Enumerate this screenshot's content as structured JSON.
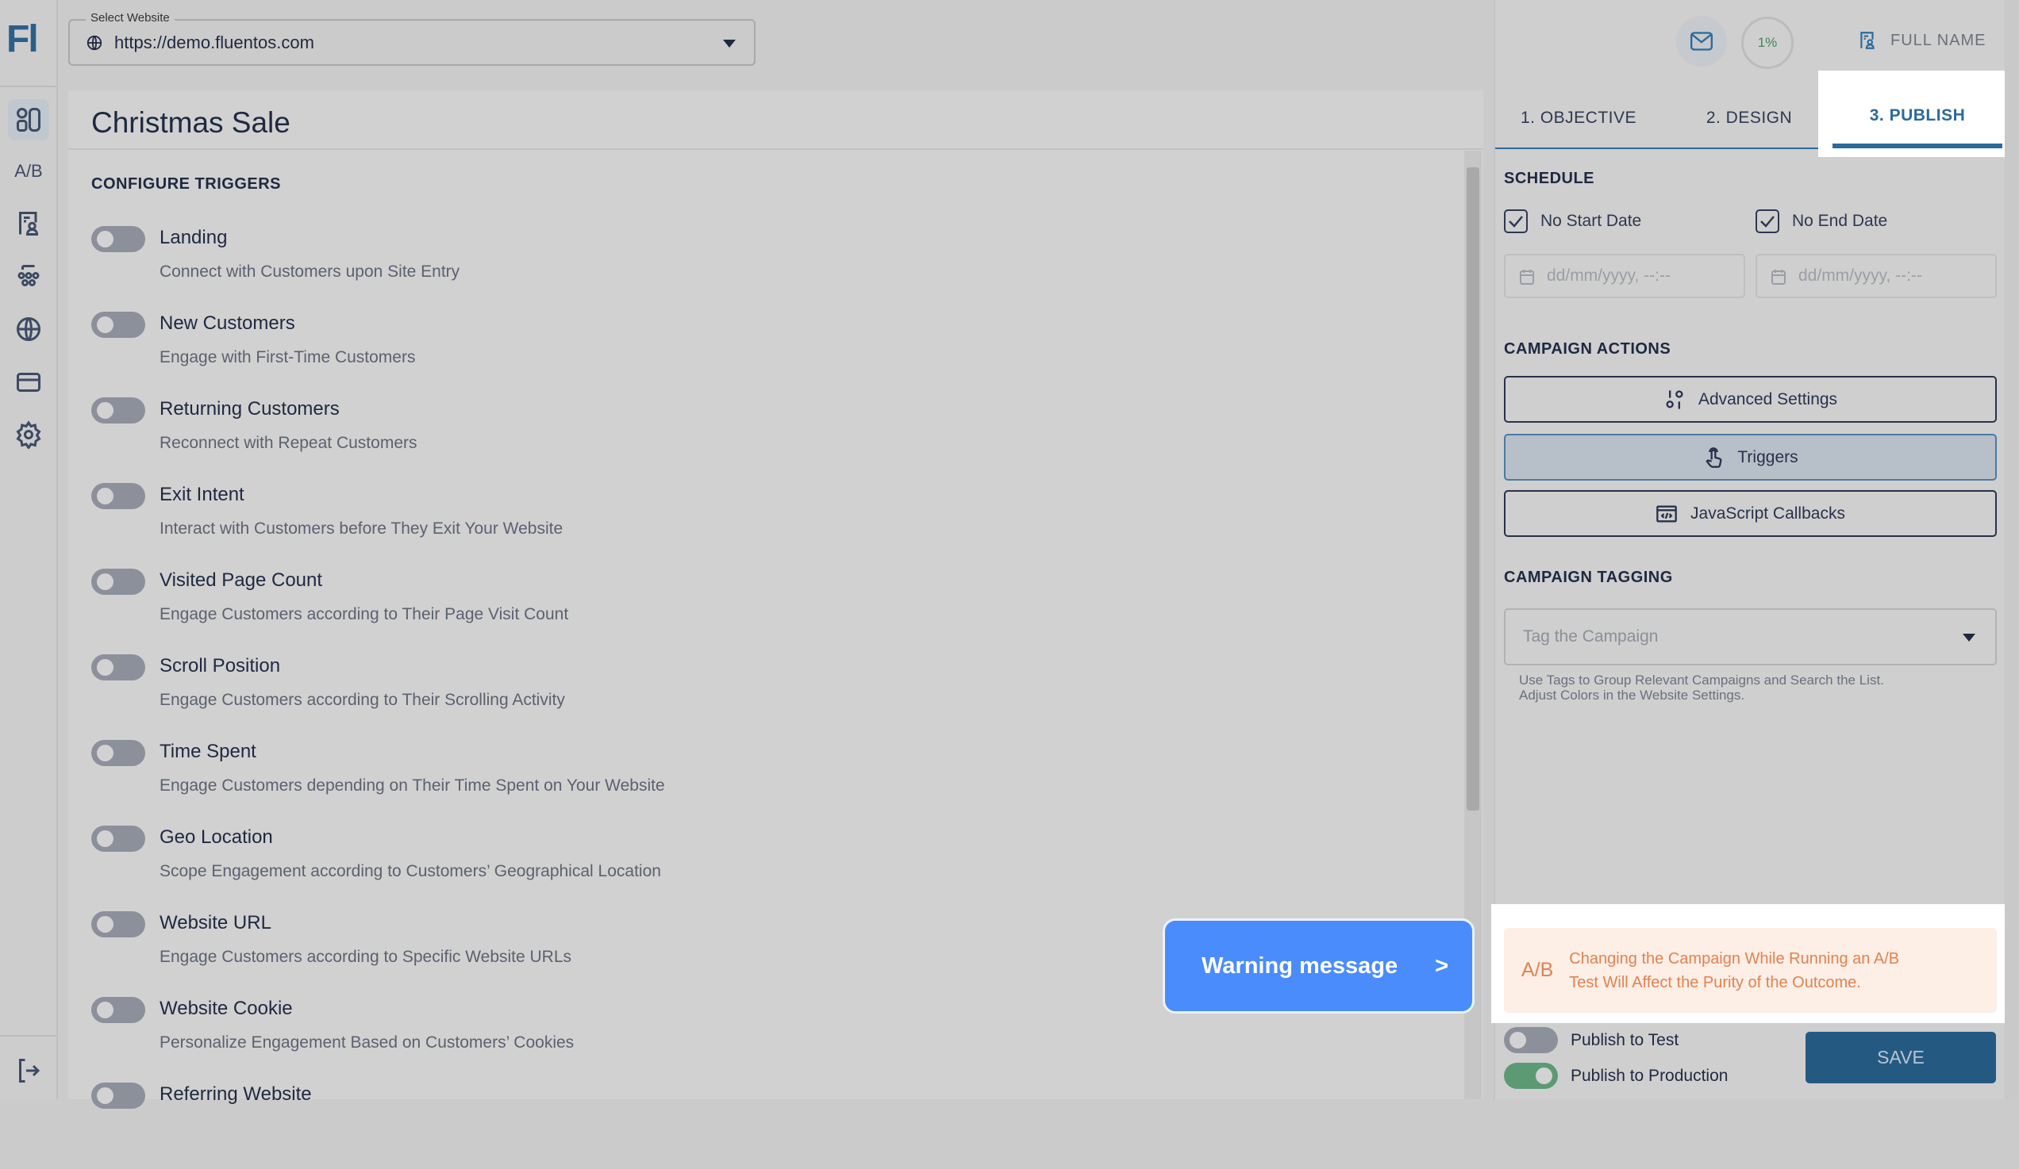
{
  "app": {
    "logo": "Fl"
  },
  "sidebar": {
    "items": [
      {
        "name": "dashboard",
        "icon": "dashboard-icon"
      },
      {
        "name": "ab-test",
        "label": "A/B"
      },
      {
        "name": "contacts",
        "icon": "contact-card-icon"
      },
      {
        "name": "audience",
        "icon": "users-group-icon"
      },
      {
        "name": "websites",
        "icon": "globe-icon"
      },
      {
        "name": "billing",
        "icon": "credit-card-icon"
      },
      {
        "name": "settings",
        "icon": "gear-icon"
      }
    ],
    "logout_icon": "logout-icon"
  },
  "site_select": {
    "label": "Select Website",
    "value": "https://demo.fluentos.com"
  },
  "main": {
    "title": "Christmas Sale",
    "section": "CONFIGURE TRIGGERS",
    "triggers": [
      {
        "title": "Landing",
        "desc": "Connect with Customers upon Site Entry",
        "on": false
      },
      {
        "title": "New Customers",
        "desc": "Engage with First-Time Customers",
        "on": false
      },
      {
        "title": "Returning Customers",
        "desc": "Reconnect with Repeat Customers",
        "on": false
      },
      {
        "title": "Exit Intent",
        "desc": "Interact with Customers before They Exit Your Website",
        "on": false
      },
      {
        "title": "Visited Page Count",
        "desc": "Engage Customers according to Their Page Visit Count",
        "on": false
      },
      {
        "title": "Scroll Position",
        "desc": "Engage Customers according to Their Scrolling Activity",
        "on": false
      },
      {
        "title": "Time Spent",
        "desc": "Engage Customers depending on Their Time Spent on Your Website",
        "on": false
      },
      {
        "title": "Geo Location",
        "desc": "Scope Engagement according to Customers’ Geographical Location",
        "on": false
      },
      {
        "title": "Website URL",
        "desc": "Engage Customers according to Specific Website URLs",
        "on": false
      },
      {
        "title": "Website Cookie",
        "desc": "Personalize Engagement Based on Customers’ Cookies",
        "on": false
      },
      {
        "title": "Referring Website",
        "desc": "",
        "on": false
      }
    ]
  },
  "header": {
    "progress": "1%",
    "progress_value": 1,
    "user": "FULL NAME"
  },
  "tabs": [
    {
      "label": "1. OBJECTIVE"
    },
    {
      "label": "2. DESIGN"
    },
    {
      "label": "3. PUBLISH",
      "active": true
    }
  ],
  "schedule": {
    "heading": "SCHEDULE",
    "no_start": "No Start Date",
    "no_end": "No End Date",
    "start_placeholder": "dd/mm/yyyy, --:--",
    "end_placeholder": "dd/mm/yyyy, --:--"
  },
  "actions": {
    "heading": "CAMPAIGN ACTIONS",
    "advanced": "Advanced Settings",
    "triggers": "Triggers",
    "callbacks": "JavaScript Callbacks"
  },
  "tagging": {
    "heading": "CAMPAIGN TAGGING",
    "placeholder": "Tag the Campaign",
    "hint1": "Use Tags to Group Relevant Campaigns and Search the List.",
    "hint2": "Adjust Colors in the Website Settings."
  },
  "warning": {
    "badge": "A/B",
    "line1": "Changing the Campaign While Running an A/B",
    "line2": "Test Will Affect the Purity of the Outcome."
  },
  "publish": {
    "test": "Publish to Test",
    "test_on": false,
    "production": "Publish to Production",
    "production_on": true,
    "save": "SAVE"
  },
  "callout": {
    "label": "Warning message",
    "arrow": ">"
  },
  "colors": {
    "accent": "#2b6a9c",
    "save": "#245a82",
    "warning_text": "#e0834f",
    "warning_bg": "#fdeee6",
    "callout": "#4a8cfb",
    "toggle_on": "#5b9a73"
  }
}
